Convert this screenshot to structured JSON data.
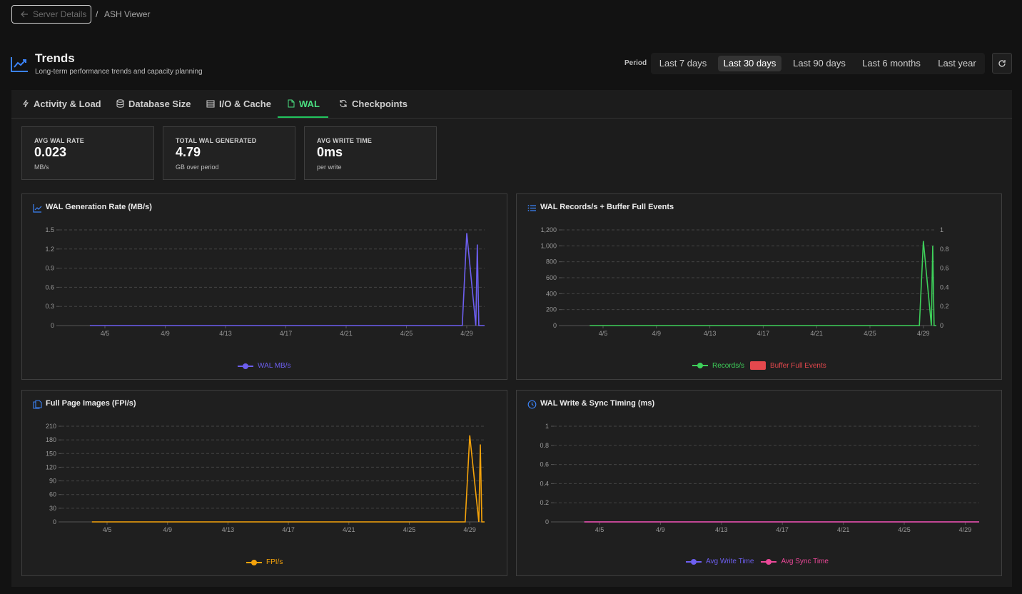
{
  "breadcrumb": {
    "back_label": "Server Details",
    "separator": "/",
    "current": "ASH Viewer"
  },
  "header": {
    "title": "Trends",
    "subtitle": "Long-term performance trends and capacity planning",
    "icon": "trending-up-icon"
  },
  "period": {
    "label": "Period",
    "options": [
      "Last 7 days",
      "Last 30 days",
      "Last 90 days",
      "Last 6 months",
      "Last year"
    ],
    "selected": "Last 30 days"
  },
  "tabs": [
    {
      "label": "Activity & Load",
      "icon": "zap-icon"
    },
    {
      "label": "Database Size",
      "icon": "database-icon"
    },
    {
      "label": "I/O & Cache",
      "icon": "hard-drive-icon"
    },
    {
      "label": "WAL",
      "icon": "file-icon",
      "active": true
    },
    {
      "label": "Checkpoints",
      "icon": "refresh-icon"
    }
  ],
  "stats": [
    {
      "label": "AVG WAL RATE",
      "value": "0.023",
      "unit": "MB/s"
    },
    {
      "label": "TOTAL WAL GENERATED",
      "value": "4.79",
      "unit": "GB over period"
    },
    {
      "label": "AVG WRITE TIME",
      "value": "0ms",
      "unit": "per write"
    }
  ],
  "colors": {
    "accent": "#22c55e",
    "wal": "#6d5ff0",
    "records": "#3ecf5a",
    "buffer": "#e5484d",
    "fpi": "#f5a30b",
    "write": "#6d5ff0",
    "sync": "#ec4899"
  },
  "chart_data": [
    {
      "title": "WAL Generation Rate (MB/s)",
      "type": "line",
      "x_ticks": [
        "4/5",
        "4/9",
        "4/13",
        "4/17",
        "4/21",
        "4/25",
        "4/29"
      ],
      "y_ticks": [
        "0",
        "0.3",
        "0.6",
        "0.9",
        "1.2",
        "1.5"
      ],
      "ylim": [
        0,
        1.5
      ],
      "series": [
        {
          "name": "WAL MB/s",
          "points": [
            [
              0,
              0
            ],
            [
              24.7,
              0
            ],
            [
              25.0,
              1.45
            ],
            [
              25.6,
              0
            ],
            [
              25.7,
              1.27
            ],
            [
              25.8,
              0
            ],
            [
              30,
              0
            ]
          ]
        }
      ],
      "grid": true,
      "legend": "bottom"
    },
    {
      "title": "WAL Records/s + Buffer Full Events",
      "type": "line",
      "x_ticks": [
        "4/5",
        "4/9",
        "4/13",
        "4/17",
        "4/21",
        "4/25",
        "4/29"
      ],
      "y_ticks": [
        "0",
        "200",
        "400",
        "600",
        "800",
        "1,000",
        "1,200"
      ],
      "y2_ticks": [
        "0",
        "0.2",
        "0.4",
        "0.6",
        "0.8",
        "1"
      ],
      "ylim": [
        0,
        1200
      ],
      "y2lim": [
        0,
        1
      ],
      "series": [
        {
          "name": "Records/s",
          "points": [
            [
              0,
              0
            ],
            [
              24.7,
              0
            ],
            [
              25.0,
              1060
            ],
            [
              25.6,
              0
            ],
            [
              25.7,
              1000
            ],
            [
              25.8,
              0
            ],
            [
              30,
              0
            ]
          ]
        },
        {
          "name": "Buffer Full Events",
          "values": [
            0
          ]
        }
      ],
      "grid": true,
      "legend": "bottom"
    },
    {
      "title": "Full Page Images (FPI/s)",
      "type": "line",
      "x_ticks": [
        "4/5",
        "4/9",
        "4/13",
        "4/17",
        "4/21",
        "4/25",
        "4/29"
      ],
      "y_ticks": [
        "0",
        "30",
        "60",
        "90",
        "120",
        "150",
        "180",
        "210"
      ],
      "ylim": [
        0,
        210
      ],
      "series": [
        {
          "name": "FPI/s",
          "points": [
            [
              0,
              0
            ],
            [
              24.7,
              0
            ],
            [
              25.0,
              190
            ],
            [
              25.6,
              0
            ],
            [
              25.7,
              170
            ],
            [
              25.8,
              0
            ],
            [
              30,
              0
            ]
          ]
        }
      ],
      "grid": true,
      "legend": "bottom"
    },
    {
      "title": "WAL Write & Sync Timing (ms)",
      "type": "line",
      "x_ticks": [
        "4/5",
        "4/9",
        "4/13",
        "4/17",
        "4/21",
        "4/25",
        "4/29"
      ],
      "y_ticks": [
        "0",
        "0.2",
        "0.4",
        "0.6",
        "0.8",
        "1"
      ],
      "ylim": [
        0,
        1
      ],
      "series": [
        {
          "name": "Avg Write Time",
          "points": [
            [
              0,
              0
            ],
            [
              30,
              0
            ]
          ]
        },
        {
          "name": "Avg Sync Time",
          "points": [
            [
              0,
              0
            ],
            [
              30,
              0
            ]
          ]
        }
      ],
      "grid": true,
      "legend": "bottom"
    }
  ]
}
